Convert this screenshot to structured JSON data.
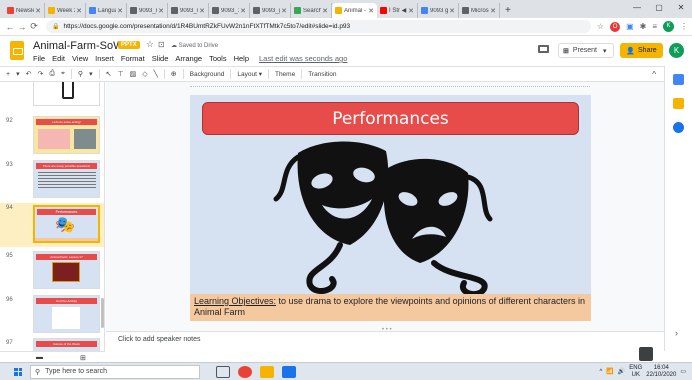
{
  "browser": {
    "tabs": [
      {
        "label": "Newsle",
        "color": "#ea4335"
      },
      {
        "label": "Week 2",
        "color": "#f4b400"
      },
      {
        "label": "Langua",
        "color": "#4285f4"
      },
      {
        "label": "9093_m",
        "color": "#5f6368"
      },
      {
        "label": "9093_m",
        "color": "#5f6368"
      },
      {
        "label": "9093_1:",
        "color": "#5f6368"
      },
      {
        "label": "9093_g:",
        "color": "#5f6368"
      },
      {
        "label": "Search r",
        "color": "#34a853"
      },
      {
        "label": "Animal -",
        "color": "#f4b400",
        "active": true
      },
      {
        "label": "I Str ◀",
        "color": "#ff0000"
      },
      {
        "label": "9093 g:",
        "color": "#4285f4"
      },
      {
        "label": "Microso",
        "color": "#5f6368"
      }
    ],
    "new_tab": "+",
    "url": "https://docs.google.com/presentation/d/1R4BUmtRZkFUvW2n1nFtXTfTMtk7c5to7/edit#slide=id.p93"
  },
  "docs": {
    "title": "Animal-Farm-SoW",
    "badge": "PPTX",
    "saved_label": "Saved to Drive",
    "menus": [
      "File",
      "Edit",
      "View",
      "Insert",
      "Format",
      "Slide",
      "Arrange",
      "Tools",
      "Help"
    ],
    "last_edit": "Last edit was seconds ago",
    "present_label": "Present",
    "share_label": "Share",
    "avatar_initial": "K"
  },
  "toolbar": {
    "background": "Background",
    "layout": "Layout ▾",
    "theme": "Theme",
    "transition": "Transition"
  },
  "filmstrip": [
    {
      "num": "",
      "title": ""
    },
    {
      "num": "92",
      "title": "Let's do some acting!"
    },
    {
      "num": "93",
      "title": "There are many possible questions!"
    },
    {
      "num": "94",
      "title": "Performances",
      "selected": true
    },
    {
      "num": "95",
      "title": "Animal Farm: Lesson 17"
    },
    {
      "num": "96",
      "title": "Hot Pen Activity"
    },
    {
      "num": "97",
      "title": "Games of the Week"
    }
  ],
  "slide": {
    "title": "Performances",
    "objectives_label": "Learning Objectives:",
    "objectives_text": " to use drama to explore the viewpoints and opinions of different characters in Animal Farm"
  },
  "notes_placeholder": "Click to add speaker notes",
  "taskbar": {
    "search_placeholder": "Type here to search",
    "lang": "ENG",
    "region": "UK",
    "time": "16:04",
    "date": "22/10/2020"
  },
  "colors": {
    "accent": "#f4b400",
    "banner": "#e84c4a",
    "slide_bg": "#d6e2f1",
    "objectives_bg": "#f5c9a0"
  }
}
